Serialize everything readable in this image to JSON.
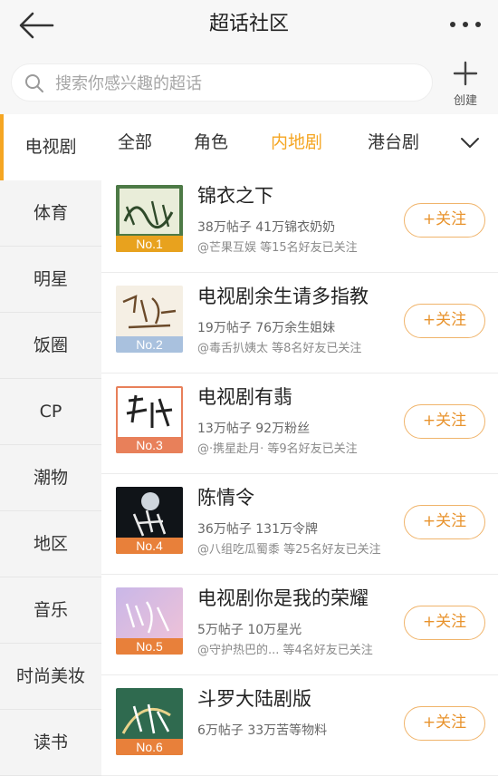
{
  "header": {
    "title": "超话社区",
    "back_icon": "back-arrow-icon",
    "more_icon": "more-dots-icon"
  },
  "search": {
    "placeholder": "搜索你感兴趣的超话",
    "icon": "search-icon"
  },
  "create": {
    "label": "创建",
    "icon": "plus-icon"
  },
  "sidebar": {
    "accent": "#f5a623",
    "items": [
      {
        "label": "电视剧",
        "active": true
      },
      {
        "label": "体育"
      },
      {
        "label": "明星"
      },
      {
        "label": "饭圈"
      },
      {
        "label": "CP"
      },
      {
        "label": "潮物"
      },
      {
        "label": "地区"
      },
      {
        "label": "音乐"
      },
      {
        "label": "时尚美妆"
      },
      {
        "label": "读书"
      }
    ]
  },
  "tabs": {
    "items": [
      {
        "label": "全部"
      },
      {
        "label": "角色"
      },
      {
        "label": "内地剧",
        "active": true
      },
      {
        "label": "港台剧"
      }
    ],
    "expand_icon": "chevron-down-icon"
  },
  "topics": [
    {
      "name": "锦衣之下",
      "stats": "38万帖子 41万锦衣奶奶",
      "friends": "@芒果互娱 等15名好友已关注",
      "rank": "No.1",
      "rank_color": "#e8a21e",
      "follow": "+关注",
      "thumb_text": "锦衣之下"
    },
    {
      "name": "电视剧余生请多指教",
      "stats": "19万帖子 76万余生姐妹",
      "friends": "@毒舌扒姨太 等8名好友已关注",
      "rank": "No.2",
      "rank_color": "#9fb8d6",
      "follow": "+关注",
      "thumb_text": "余生请多指教"
    },
    {
      "name": "电视剧有翡",
      "stats": "13万帖子 92万粉丝",
      "friends": "@·携星赴月· 等9名好友已关注",
      "rank": "No.3",
      "rank_color": "#e8805a",
      "follow": "+关注",
      "thumb_text": "有翡"
    },
    {
      "name": "陈情令",
      "stats": "36万帖子 131万令牌",
      "friends": "@八组吃瓜蜀黍 等25名好友已关注",
      "rank": "No.4",
      "rank_color": "#e8803a",
      "follow": "+关注",
      "thumb_text": "陈情令"
    },
    {
      "name": "电视剧你是我的荣耀",
      "stats": "5万帖子 10万星光",
      "friends": "@守护热巴的... 等4名好友已关注",
      "rank": "No.5",
      "rank_color": "#e8803a",
      "follow": "+关注",
      "thumb_text": "你是我的荣耀"
    },
    {
      "name": "斗罗大陆剧版",
      "stats": "6万帖子 33万苦等物料",
      "friends": "",
      "rank": "No.6",
      "rank_color": "#e8803a",
      "follow": "+关注",
      "thumb_text": "斗罗大陆"
    }
  ]
}
